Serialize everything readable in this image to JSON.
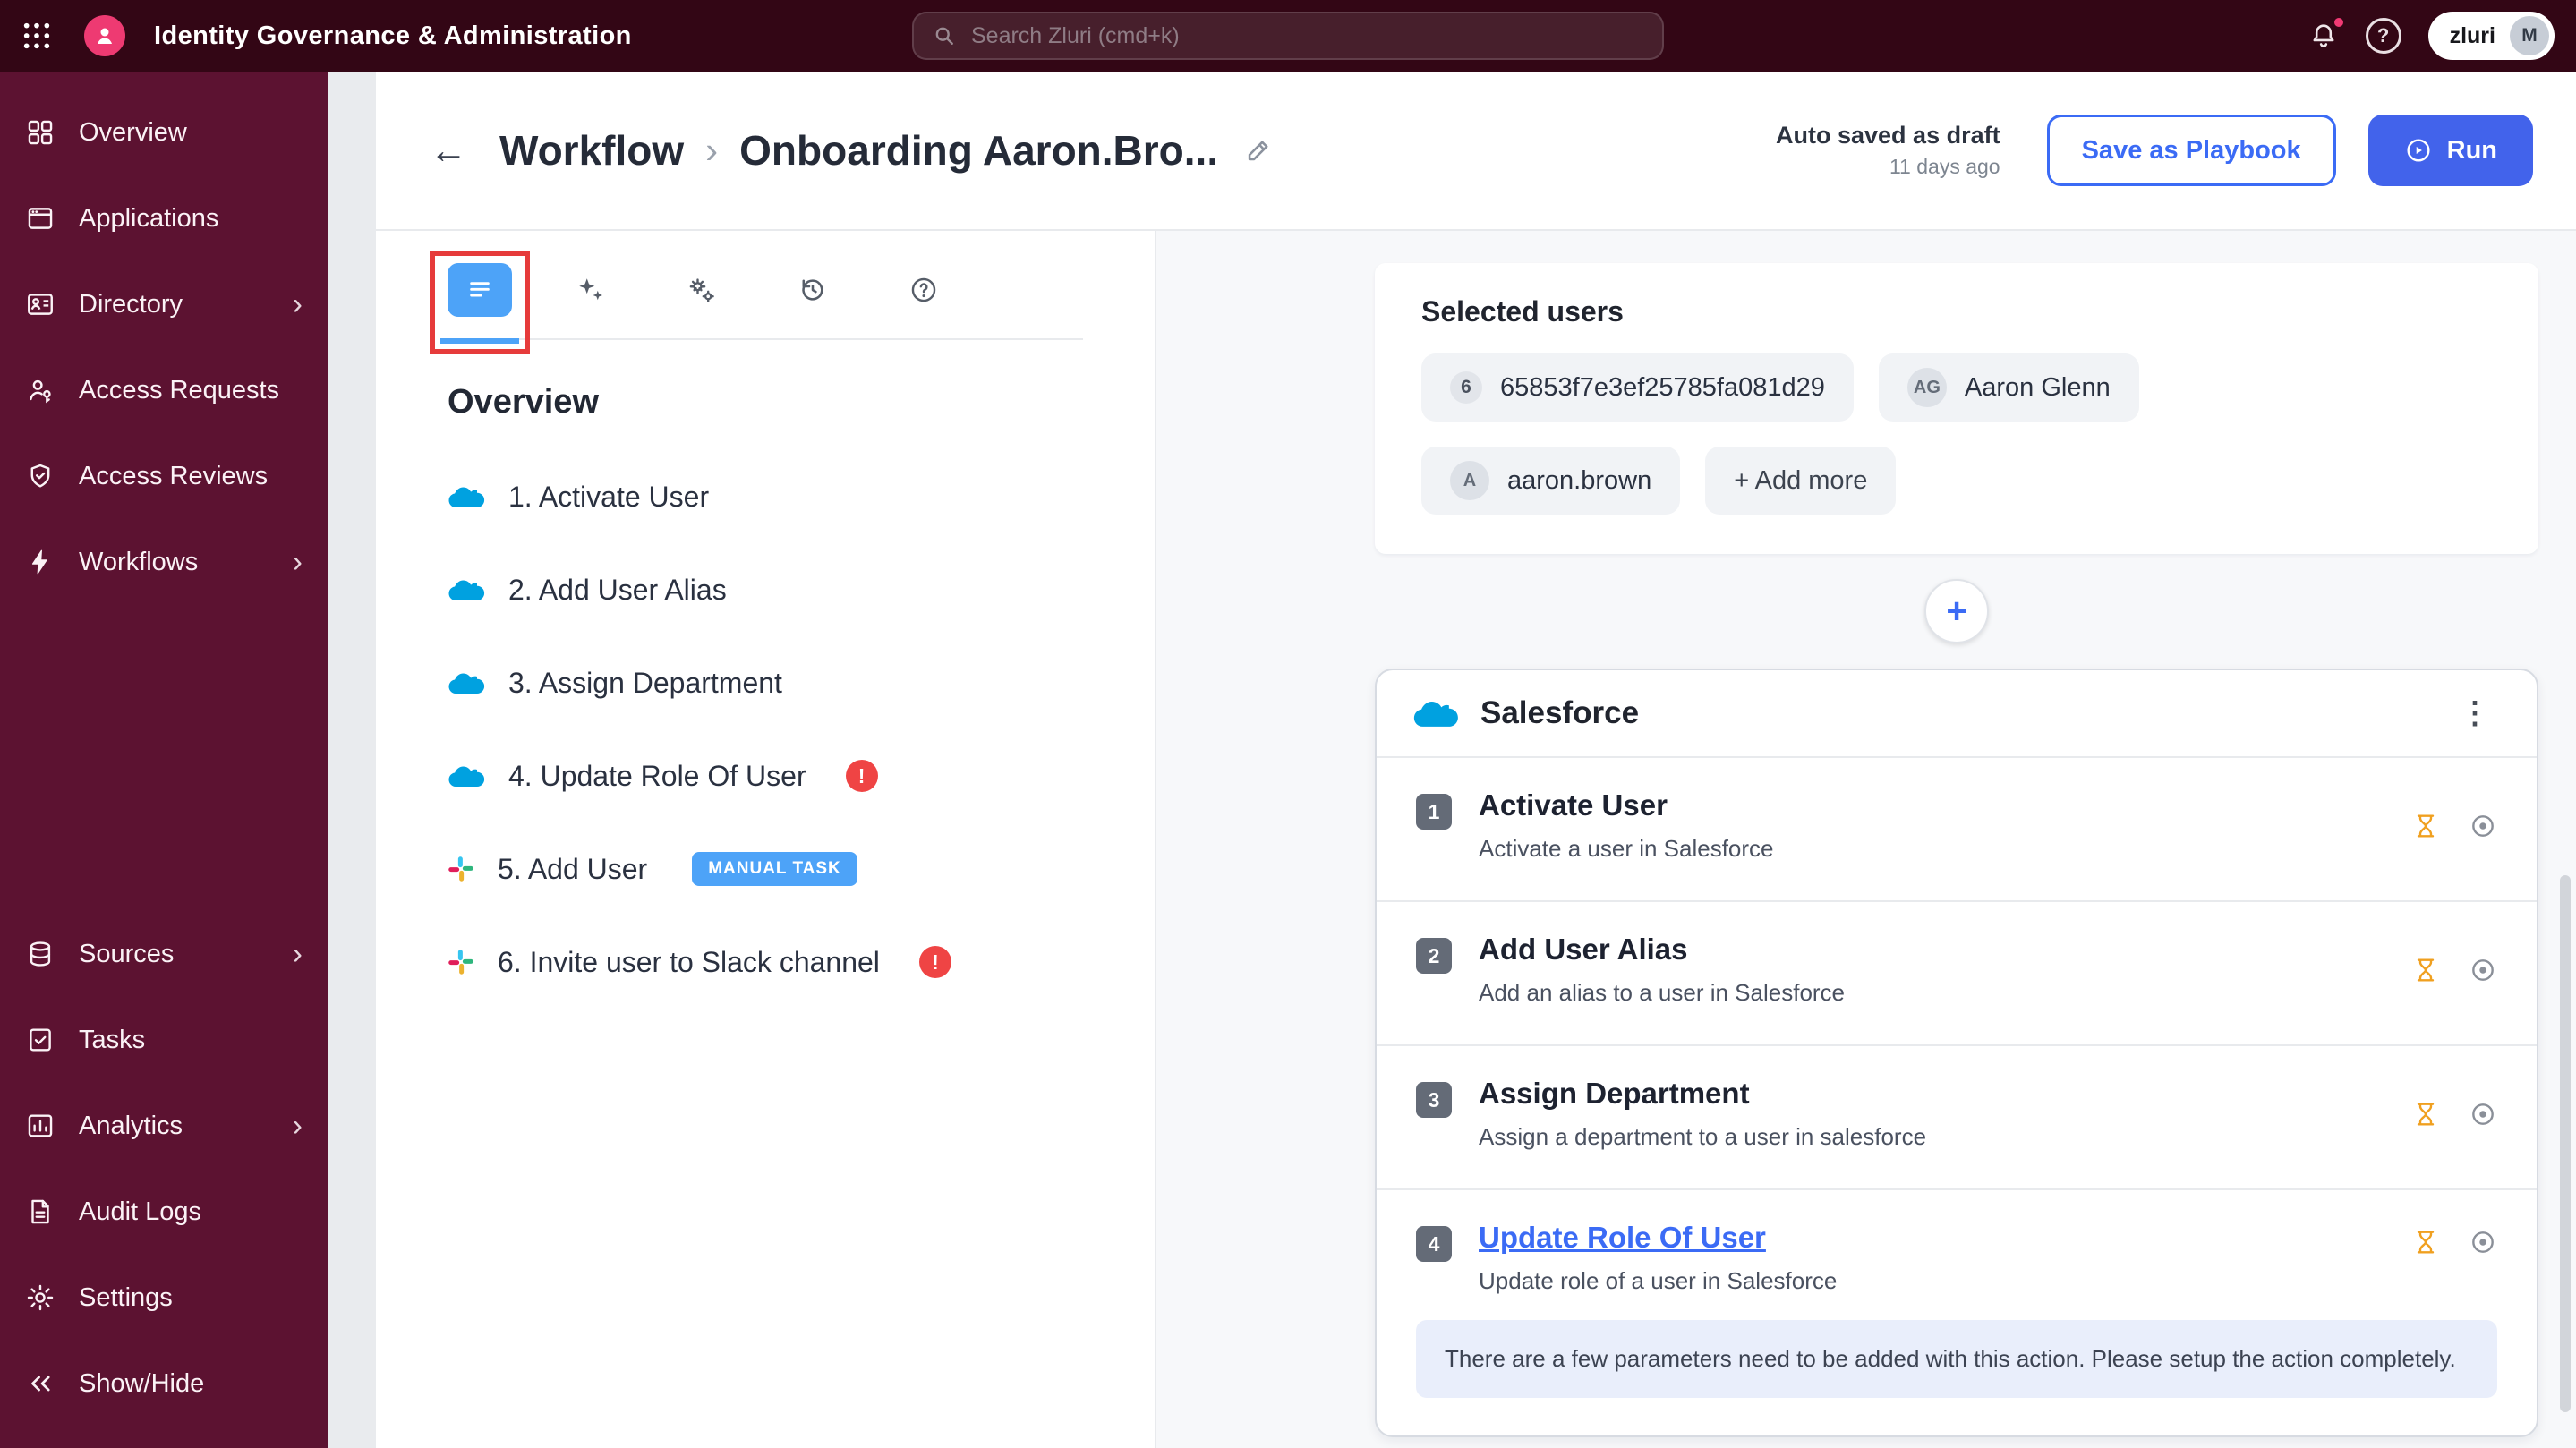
{
  "topbar": {
    "title": "Identity Governance & Administration",
    "search_placeholder": "Search Zluri (cmd+k)",
    "brand": "zluri",
    "avatar_initial": "M"
  },
  "icons": {
    "chevron": "›",
    "breadcrumb_sep": "›",
    "back": "←",
    "kebab": "⋮",
    "plus": "+",
    "error": "!",
    "help": "?"
  },
  "sidebar": {
    "top_items": [
      {
        "label": "Overview"
      },
      {
        "label": "Applications"
      },
      {
        "label": "Directory"
      },
      {
        "label": "Access Requests"
      },
      {
        "label": "Access Reviews"
      },
      {
        "label": "Workflows"
      }
    ],
    "bottom_items": [
      {
        "label": "Sources"
      },
      {
        "label": "Tasks"
      },
      {
        "label": "Analytics"
      },
      {
        "label": "Audit Logs"
      },
      {
        "label": "Settings"
      },
      {
        "label": "Show/Hide"
      }
    ]
  },
  "header": {
    "breadcrumb_root": "Workflow",
    "breadcrumb_current": "Onboarding Aaron.Bro...",
    "autosave_title": "Auto saved as draft",
    "autosave_time": "11 days ago",
    "save_playbook": "Save as Playbook",
    "run": "Run"
  },
  "left_panel": {
    "heading": "Overview",
    "steps": [
      {
        "label": "1. Activate User"
      },
      {
        "label": "2. Add User Alias"
      },
      {
        "label": "3. Assign Department"
      },
      {
        "label": "4. Update Role Of User"
      },
      {
        "label": "5. Add User",
        "badge": "MANUAL TASK"
      },
      {
        "label": "6. Invite user to Slack channel"
      }
    ]
  },
  "selected_users": {
    "title": "Selected users",
    "chip_id_badge": "6",
    "chip_id": "65853f7e3ef25785fa081d29",
    "chip_user1_avatar": "AG",
    "chip_user1": "Aaron Glenn",
    "chip_user2_avatar": "A",
    "chip_user2": "aaron.brown",
    "add_more": "+ Add more"
  },
  "action_card": {
    "app": "Salesforce",
    "actions": [
      {
        "num": "1",
        "title": "Activate User",
        "subtitle": "Activate a user in Salesforce"
      },
      {
        "num": "2",
        "title": "Add User Alias",
        "subtitle": "Add an alias to a user in Salesforce"
      },
      {
        "num": "3",
        "title": "Assign Department",
        "subtitle": "Assign a department to a user in salesforce"
      },
      {
        "num": "4",
        "title": "Update Role Of User",
        "subtitle": "Update role of a user in Salesforce",
        "warning": "There are a few parameters need to be added with this action. Please setup the action completely."
      }
    ]
  }
}
